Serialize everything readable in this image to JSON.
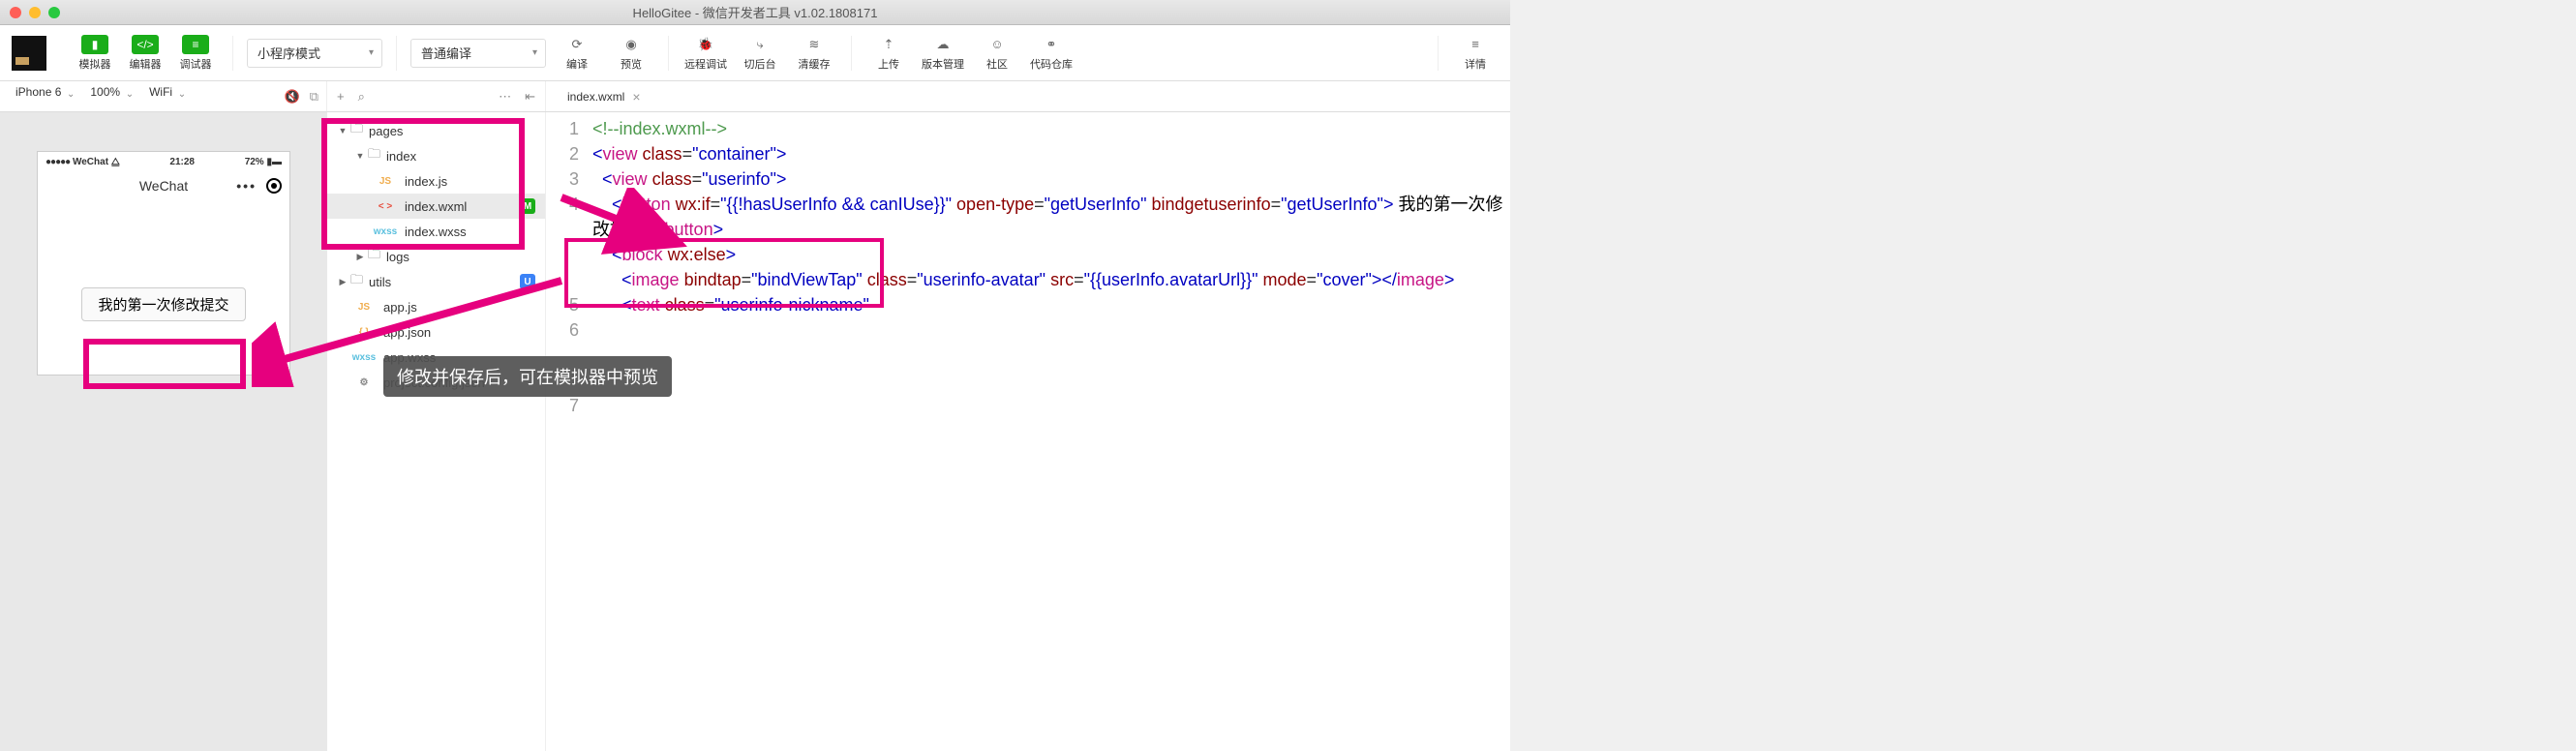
{
  "window": {
    "title": "HelloGitee - 微信开发者工具 v1.02.1808171"
  },
  "toolbar": {
    "simulator": "模拟器",
    "editor": "编辑器",
    "debugger": "调试器",
    "mode_select": "小程序模式",
    "compile_select": "普通编译",
    "compile": "编译",
    "preview": "预览",
    "remote_debug": "远程调试",
    "switch_bg": "切后台",
    "clear_cache": "清缓存",
    "upload": "上传",
    "version_mgmt": "版本管理",
    "community": "社区",
    "code_repo": "代码仓库",
    "details": "详情"
  },
  "subbar": {
    "device": "iPhone 6",
    "zoom": "100%",
    "network": "WiFi"
  },
  "sim": {
    "carrier": "WeChat",
    "signal": "●●●●●",
    "time": "21:28",
    "battery": "72%",
    "nav_title": "WeChat",
    "button_text": "我的第一次修改提交"
  },
  "tree": {
    "pages": "pages",
    "index_folder": "index",
    "index_js": "index.js",
    "index_wxml": "index.wxml",
    "index_wxss": "index.wxss",
    "logs": "logs",
    "utils": "utils",
    "app_js": "app.js",
    "app_json": "app.json",
    "app_wxss": "app.wxss",
    "project_config": "project.config.json"
  },
  "editor_tab": {
    "name": "index.wxml"
  },
  "code": {
    "l1_comment": "<!--index.wxml-->",
    "view": "view",
    "class": "class",
    "container": "\"container\"",
    "userinfo": "\"userinfo\"",
    "button": "button",
    "wxif": "wx:if",
    "wxif_val": "\"{{!hasUserInfo && canIUse}}\"",
    "open_type": "open-type",
    "open_type_val": "\"getUserInfo\"",
    "bindgetuserinfo": "bindgetuserinfo",
    "bindgetuserinfo_val": "\"getUserInfo\"",
    "button_text": " 我的第一次修改提交 ",
    "block": "block",
    "wxelse": "wx:else",
    "image": "image",
    "bindtap": "bindtap",
    "bindtap_val": "\"bindViewTap\"",
    "avatar_class": "\"userinfo-avatar\"",
    "src": "src",
    "src_val": "\"{{userInfo.avatarUrl}}\"",
    "mode": "mode",
    "mode_val": "\"cover\"",
    "text": "text",
    "nickname_class": "\"userinfo-nickname\""
  },
  "tooltip": {
    "text": "修改并保存后，可在模拟器中预览"
  }
}
